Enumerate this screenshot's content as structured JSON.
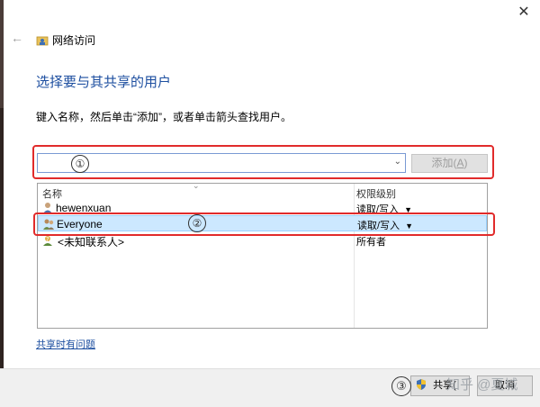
{
  "window": {
    "title": "网络访问",
    "close_glyph": "✕",
    "back_glyph": "←"
  },
  "main": {
    "heading": "选择要与其共享的用户",
    "instruction": "键入名称，然后单击“添加”，或者单击箭头查找用户。"
  },
  "input": {
    "value": "",
    "add_label_prefix": "添加(",
    "add_label_key": "A",
    "add_label_suffix": ")"
  },
  "list": {
    "columns": [
      "名称",
      "权限级别"
    ],
    "rows": [
      {
        "name": "hewenxuan",
        "permission": "读取/写入",
        "dropdown": true,
        "selected": false
      },
      {
        "name": "Everyone",
        "permission": "读取/写入",
        "dropdown": true,
        "selected": true
      },
      {
        "name": "<未知联系人>",
        "permission": "所有者",
        "dropdown": false,
        "selected": false
      }
    ]
  },
  "annotations": [
    "①",
    "②",
    "③"
  ],
  "footer": {
    "help_link": "共享时有问题",
    "share_label": "共享(",
    "cancel_label": "取消"
  },
  "watermark": "知乎 @夏城",
  "colors": {
    "accent": "#1e4fa0",
    "highlight_box": "#e12b2b",
    "selection": "#cce8ff"
  },
  "icons": [
    "back-arrow-icon",
    "network-folder-icon",
    "close-icon",
    "chevron-down-icon",
    "user-icon",
    "group-icon",
    "unknown-contact-icon",
    "uac-shield-icon"
  ]
}
